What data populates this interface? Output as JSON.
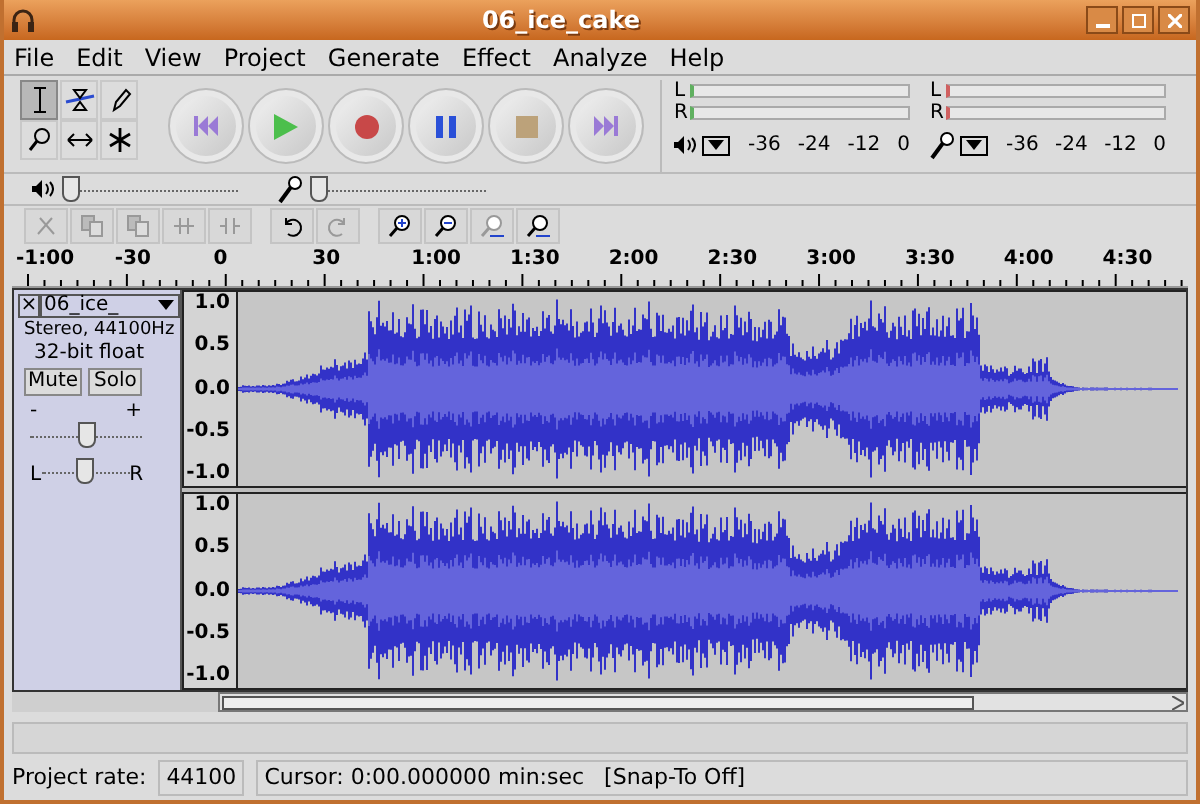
{
  "window": {
    "title": "06_ice_cake"
  },
  "menu": [
    {
      "label": "File"
    },
    {
      "label": "Edit"
    },
    {
      "label": "View"
    },
    {
      "label": "Project"
    },
    {
      "label": "Generate"
    },
    {
      "label": "Effect"
    },
    {
      "label": "Analyze"
    },
    {
      "label": "Help"
    }
  ],
  "tools": [
    {
      "kind": "ibeam",
      "selected": true
    },
    {
      "kind": "envelope",
      "selected": false
    },
    {
      "kind": "pencil",
      "selected": false
    },
    {
      "kind": "zoom",
      "selected": false
    },
    {
      "kind": "timeshift",
      "selected": false
    },
    {
      "kind": "multi",
      "selected": false
    }
  ],
  "transport": [
    {
      "kind": "skip-start"
    },
    {
      "kind": "play"
    },
    {
      "kind": "record"
    },
    {
      "kind": "pause"
    },
    {
      "kind": "stop"
    },
    {
      "kind": "skip-end"
    }
  ],
  "meters": [
    {
      "kind": "playback",
      "channels": [
        "L",
        "R"
      ],
      "scale": [
        "-36",
        "-24",
        "-12",
        "0"
      ]
    },
    {
      "kind": "recording",
      "channels": [
        "L",
        "R"
      ],
      "scale": [
        "-36",
        "-24",
        "-12",
        "0"
      ]
    }
  ],
  "mixer": [
    {
      "kind": "playback",
      "level": 0.0
    },
    {
      "kind": "recording",
      "level": 0.0
    }
  ],
  "edit_tools": [
    {
      "kind": "cut"
    },
    {
      "kind": "copy"
    },
    {
      "kind": "paste"
    },
    {
      "kind": "trim"
    },
    {
      "kind": "silence"
    },
    {
      "kind": "undo"
    },
    {
      "kind": "redo"
    },
    {
      "kind": "zoom-in"
    },
    {
      "kind": "zoom-out"
    },
    {
      "kind": "fit-selection"
    },
    {
      "kind": "fit-project"
    }
  ],
  "ruler": [
    "-1:00",
    "-30",
    "0",
    "30",
    "1:00",
    "1:30",
    "2:00",
    "2:30",
    "3:00",
    "3:30",
    "4:00",
    "4:30"
  ],
  "track": {
    "close": "×",
    "name": "06_ice_",
    "info": [
      "Stereo, 44100Hz",
      "32-bit float"
    ],
    "mute": "Mute",
    "solo": "Solo",
    "gain": {
      "min": "-",
      "max": "+",
      "level": 0.5
    },
    "pan": {
      "left": "L",
      "right": "R",
      "level": 0.5
    },
    "channels": [
      {
        "scale": [
          "1.0",
          "0.5",
          "0.0",
          "-0.5",
          "-1.0"
        ]
      },
      {
        "scale": [
          "1.0",
          "0.5",
          "0.0",
          "-0.5",
          "-1.0"
        ]
      }
    ]
  },
  "status_bar": {
    "rate_label": "Project rate:",
    "rate": "44100",
    "cursor": "Cursor: 0:00.000000 min:sec",
    "snap": "[Snap-To Off]"
  }
}
